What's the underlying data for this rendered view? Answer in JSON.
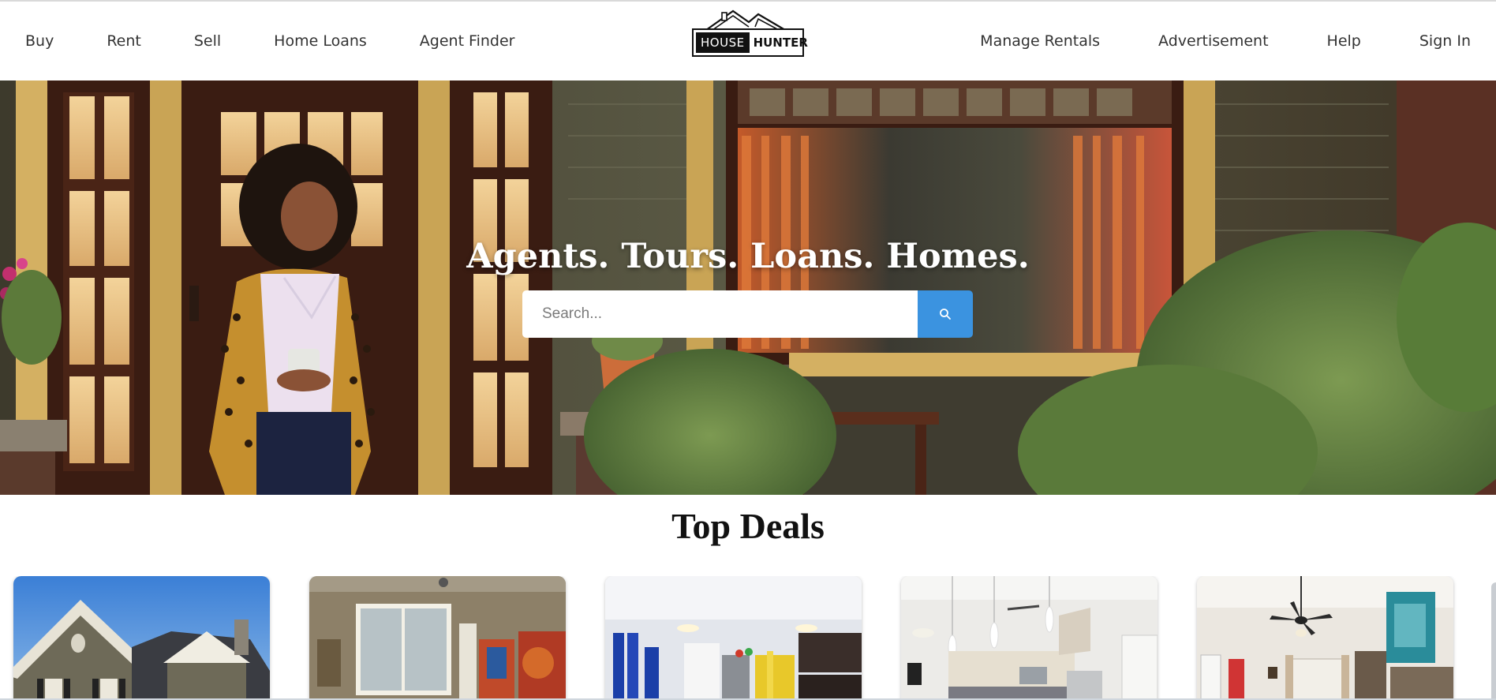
{
  "brand": {
    "word_house": "HOUSE",
    "word_hunter": "HUNTER"
  },
  "nav": {
    "left": [
      {
        "label": "Buy"
      },
      {
        "label": "Rent"
      },
      {
        "label": "Sell"
      },
      {
        "label": "Home Loans"
      },
      {
        "label": "Agent Finder"
      }
    ],
    "right": [
      {
        "label": "Manage Rentals"
      },
      {
        "label": "Advertisement"
      },
      {
        "label": "Help"
      },
      {
        "label": "Sign In"
      }
    ]
  },
  "hero": {
    "headline": "Agents. Tours. Loans. Homes.",
    "search": {
      "placeholder": "Search...",
      "value": "",
      "button_icon": "search-icon"
    }
  },
  "deals": {
    "title": "Top Deals",
    "cards": [
      {
        "scene": "house-exterior"
      },
      {
        "scene": "living-room-window"
      },
      {
        "scene": "kitchen-blue-curtains"
      },
      {
        "scene": "white-kitchen-pendants"
      },
      {
        "scene": "living-room-ceiling-fan"
      }
    ]
  },
  "colors": {
    "search_button": "#3b93e0",
    "text_dark": "#111111",
    "nav_text": "#333333"
  }
}
